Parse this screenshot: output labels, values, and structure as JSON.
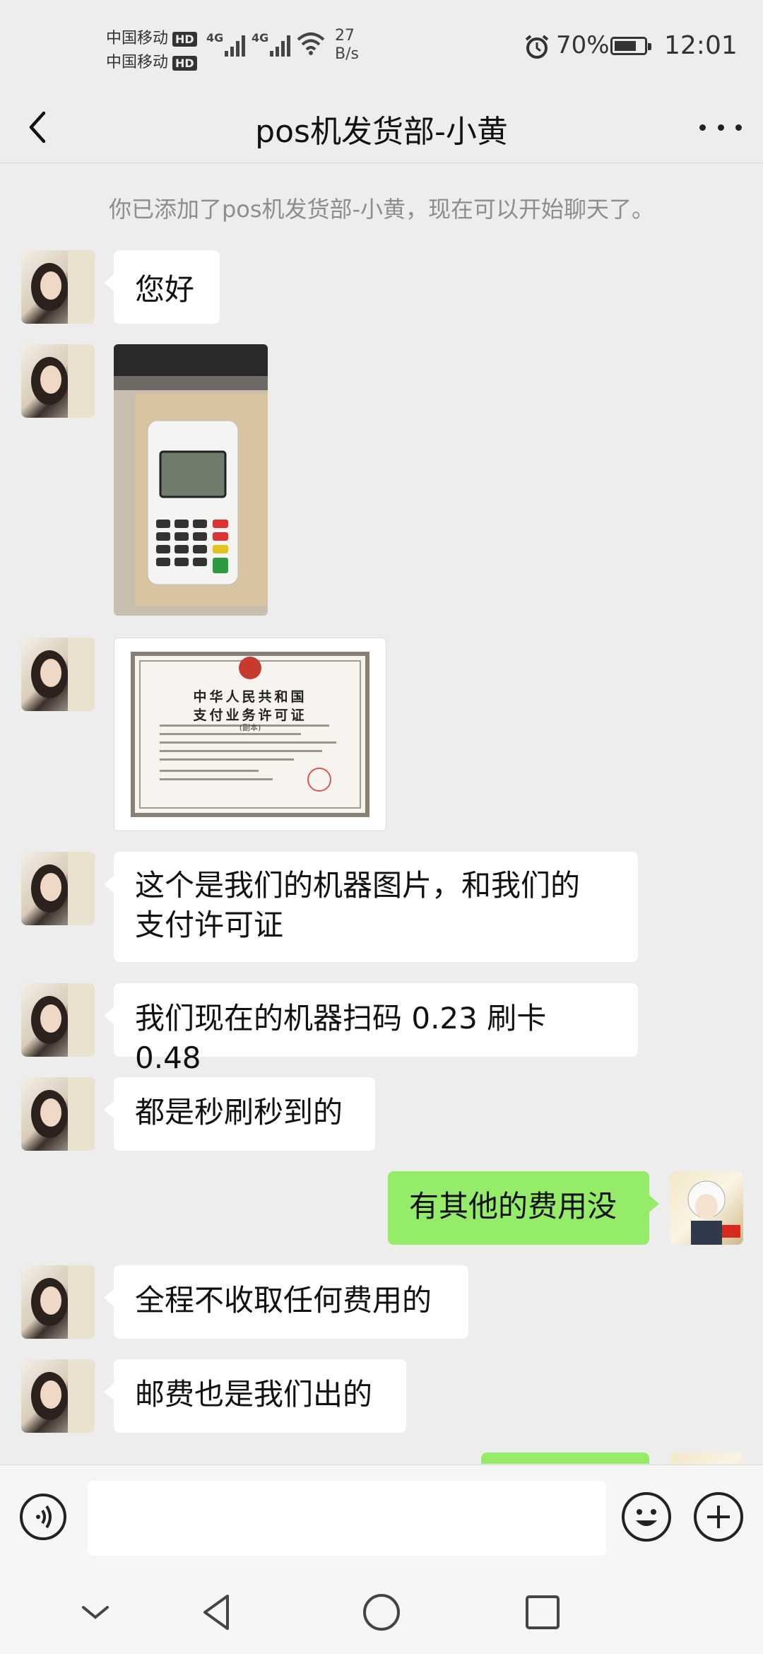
{
  "status_bar": {
    "carrier1": "中国移动",
    "carrier2": "中国移动",
    "hd_badge": "HD",
    "network": "4G",
    "net_speed_value": "27",
    "net_speed_unit": "B/s",
    "battery": "70%",
    "time": "12:01"
  },
  "header": {
    "title": "pos机发货部-小黄",
    "back_icon": "chevron-left-icon",
    "more_icon": "more-dots-icon"
  },
  "chat": {
    "system_message": "你已添加了pos机发货部-小黄，现在可以开始聊天了。",
    "messages": [
      {
        "from": "them",
        "type": "text",
        "text": "您好"
      },
      {
        "from": "them",
        "type": "image",
        "alt": "pos-terminal-photo"
      },
      {
        "from": "them",
        "type": "image",
        "alt": "payment-license-photo"
      },
      {
        "from": "them",
        "type": "text",
        "line1": "这个是我们的机器图片，和我们的",
        "line2": "支付许可证"
      },
      {
        "from": "them",
        "type": "text",
        "text": "我们现在的机器扫码 0.23 刷卡 0.48"
      },
      {
        "from": "them",
        "type": "text",
        "text": "都是秒刷秒到的"
      },
      {
        "from": "me",
        "type": "text",
        "text": "有其他的费用没"
      },
      {
        "from": "them",
        "type": "text",
        "text": "全程不收取任何费用的"
      },
      {
        "from": "them",
        "type": "text",
        "text": "邮费也是我们出的"
      }
    ],
    "license_image_text": {
      "title1": "中华人民共和国",
      "title2": "支付业务许可证",
      "subtitle": "(副本)"
    }
  },
  "input_bar": {
    "voice_icon": "voice-icon",
    "emoji_icon": "emoji-icon",
    "plus_icon": "plus-icon",
    "placeholder": ""
  },
  "nav_bar": {
    "icons": [
      "chevron-down-icon",
      "back-triangle-icon",
      "home-circle-icon",
      "recents-square-icon"
    ]
  },
  "colors": {
    "background": "#ededed",
    "incoming_bubble": "#ffffff",
    "outgoing_bubble": "#95ec69",
    "system_text": "#8d8d8d"
  }
}
